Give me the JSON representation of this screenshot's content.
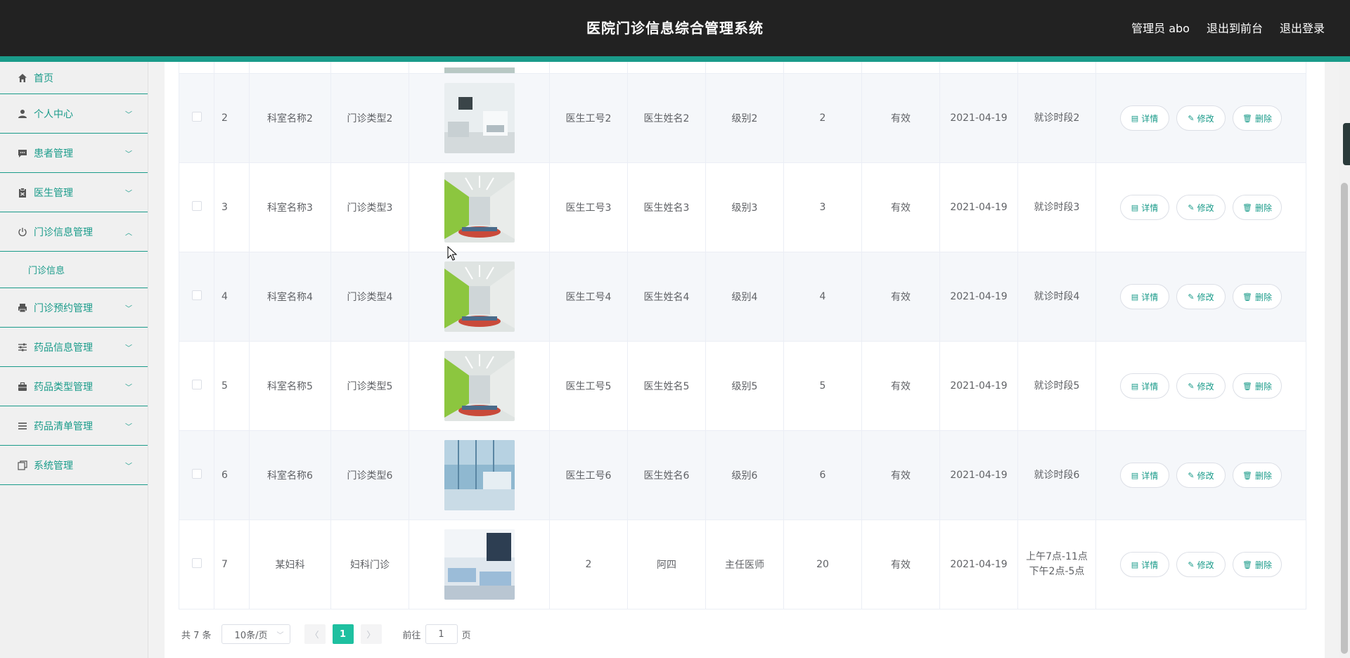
{
  "header": {
    "title": "医院门诊信息综合管理系统",
    "user": "管理员 abo",
    "to_front": "退出到前台",
    "logout": "退出登录"
  },
  "sidebar": {
    "items": [
      {
        "label": "首页",
        "icon": "home-icon"
      },
      {
        "label": "个人中心",
        "icon": "user-icon"
      },
      {
        "label": "患者管理",
        "icon": "chat-icon"
      },
      {
        "label": "医生管理",
        "icon": "clipboard-icon"
      },
      {
        "label": "门诊信息管理",
        "icon": "power-icon",
        "expanded": true
      },
      {
        "label": "门诊预约管理",
        "icon": "printer-icon"
      },
      {
        "label": "药品信息管理",
        "icon": "sliders-icon"
      },
      {
        "label": "药品类型管理",
        "icon": "briefcase-icon"
      },
      {
        "label": "药品清单管理",
        "icon": "list-icon"
      },
      {
        "label": "系统管理",
        "icon": "copy-icon"
      }
    ],
    "sub_item": "门诊信息"
  },
  "table": {
    "rows": [
      {
        "index": "2",
        "dept": "科室名称2",
        "type": "门诊类型2",
        "doctor_no": "医生工号2",
        "doctor_name": "医生姓名2",
        "level": "级别2",
        "count": "2",
        "status": "有效",
        "date": "2021-04-19",
        "period": [
          "就诊时段2"
        ],
        "image": "clinic-room-white"
      },
      {
        "index": "3",
        "dept": "科室名称3",
        "type": "门诊类型3",
        "doctor_no": "医生工号3",
        "doctor_name": "医生姓名3",
        "level": "级别3",
        "count": "3",
        "status": "有效",
        "date": "2021-04-19",
        "period": [
          "就诊时段3"
        ],
        "image": "clinic-hall-green"
      },
      {
        "index": "4",
        "dept": "科室名称4",
        "type": "门诊类型4",
        "doctor_no": "医生工号4",
        "doctor_name": "医生姓名4",
        "level": "级别4",
        "count": "4",
        "status": "有效",
        "date": "2021-04-19",
        "period": [
          "就诊时段4"
        ],
        "image": "clinic-hall-green"
      },
      {
        "index": "5",
        "dept": "科室名称5",
        "type": "门诊类型5",
        "doctor_no": "医生工号5",
        "doctor_name": "医生姓名5",
        "level": "级别5",
        "count": "5",
        "status": "有效",
        "date": "2021-04-19",
        "period": [
          "就诊时段5"
        ],
        "image": "clinic-hall-green"
      },
      {
        "index": "6",
        "dept": "科室名称6",
        "type": "门诊类型6",
        "doctor_no": "医生工号6",
        "doctor_name": "医生姓名6",
        "level": "级别6",
        "count": "6",
        "status": "有效",
        "date": "2021-04-19",
        "period": [
          "就诊时段6"
        ],
        "image": "clinic-lobby-blue"
      },
      {
        "index": "7",
        "dept": "某妇科",
        "type": "妇科门诊",
        "doctor_no": "2",
        "doctor_name": "阿四",
        "level": "主任医师",
        "count": "20",
        "status": "有效",
        "date": "2021-04-19",
        "period": [
          "上午7点-11点",
          "下午2点-5点"
        ],
        "image": "ward-beds"
      }
    ],
    "actions": {
      "detail": "详情",
      "edit": "修改",
      "delete": "删除"
    }
  },
  "pagination": {
    "total": "共 7 条",
    "page_size": "10条/页",
    "current_page": "1",
    "goto_label": "前往",
    "goto_value": "1",
    "page_unit": "页"
  },
  "colors": {
    "accent": "#1a9b8a",
    "header_bg": "#222222",
    "active_page": "#1ec0a0"
  }
}
